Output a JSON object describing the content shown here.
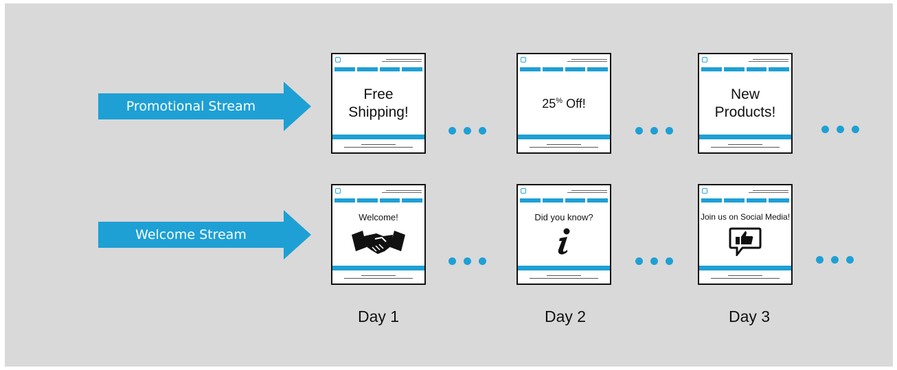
{
  "colors": {
    "accent": "#1ea0d5",
    "panel": "#d9d9d9",
    "border": "#111111"
  },
  "streams": [
    {
      "label": "Promotional Stream"
    },
    {
      "label": "Welcome Stream"
    }
  ],
  "emails": {
    "promo": [
      {
        "line1": "Free",
        "line2": "Shipping!"
      },
      {
        "value": "25",
        "suffix": "%",
        "rest": " Off!"
      },
      {
        "line1": "New",
        "line2": "Products!"
      }
    ],
    "welcome": [
      {
        "text": "Welcome!",
        "icon": "handshake-icon"
      },
      {
        "text": "Did you know?",
        "icon": "info-icon"
      },
      {
        "text": "Join us on Social Media!",
        "icon": "thumbs-up-icon"
      }
    ]
  },
  "days": [
    "Day 1",
    "Day 2",
    "Day 3"
  ]
}
